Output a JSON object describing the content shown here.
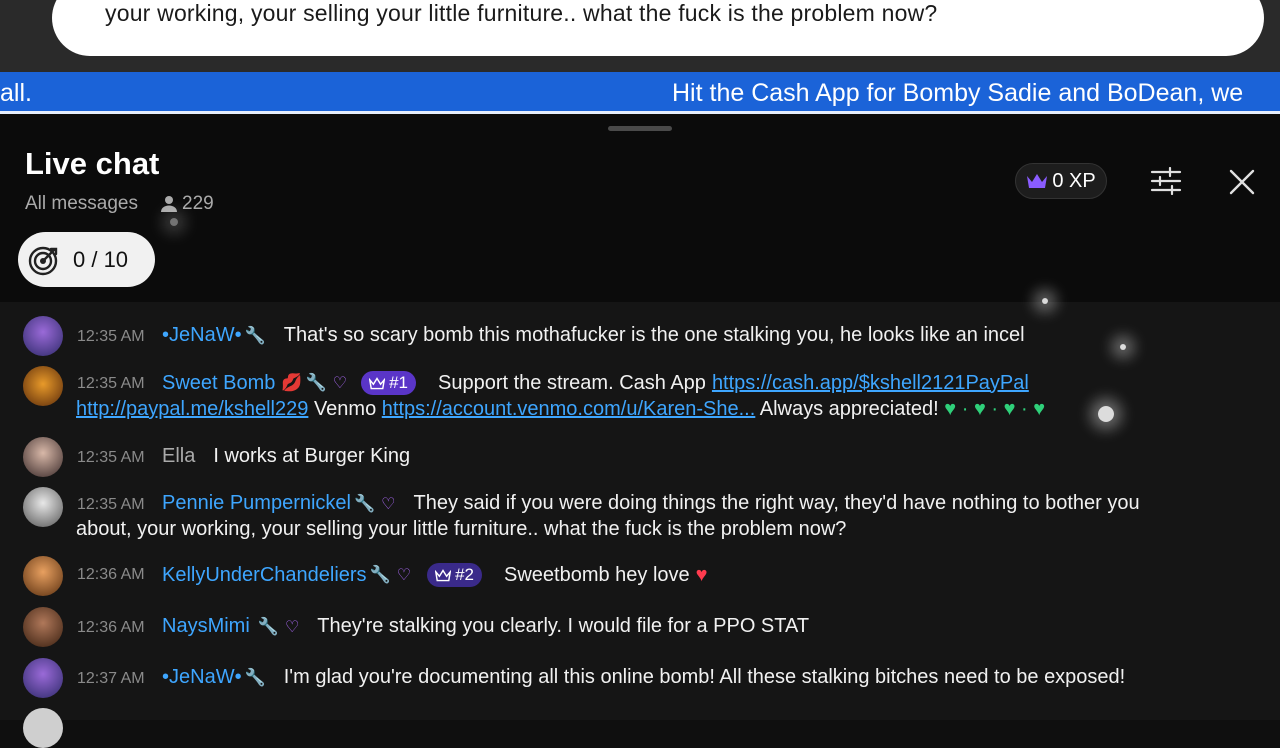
{
  "overlay": {
    "bubble_text": "your working, your selling your little furniture.. what the fuck is the problem now?",
    "ticker_left": "all.",
    "ticker_right": "Hit the Cash App for Bomby Sadie and BoDean, we"
  },
  "header": {
    "title": "Live chat",
    "filter_label": "All messages",
    "viewer_count": "229",
    "goal_progress": "0 / 10",
    "xp_label": "0 XP"
  },
  "messages": [
    {
      "time": "12:35 AM",
      "author": "•JeNaW•",
      "text": "That's so scary bomb this mothafucker is the one stalking you, he looks like an incel"
    },
    {
      "time": "12:35 AM",
      "author": "Sweet Bomb",
      "rank": "#1",
      "text_a": "Support the stream. Cash App",
      "link_1": "https://cash.app/$kshell2121PayPal",
      "link_2": "http://paypal.me/kshell229",
      "text_b": "Venmo",
      "link_3": "https://account.venmo.com/u/Karen-She...",
      "text_c": "Always appreciated!"
    },
    {
      "time": "12:35 AM",
      "author": "Ella",
      "text": "I works at Burger King"
    },
    {
      "time": "12:35 AM",
      "author": "Pennie Pumpernickel",
      "text": "They said if you were doing things the right way, they'd have nothing to bother you",
      "text_2": "about, your working, your selling your little furniture.. what the fuck is the problem now?"
    },
    {
      "time": "12:36 AM",
      "author": "KellyUnderChandeliers",
      "rank": "#2",
      "text": "Sweetbomb hey love"
    },
    {
      "time": "12:36 AM",
      "author": "NaysMimi",
      "text": "They're stalking you clearly. I would file for a PPO STAT"
    },
    {
      "time": "12:37 AM",
      "author": "•JeNaW•",
      "text": "I'm glad you're documenting all this online bomb! All these stalking bitches need to be exposed!"
    }
  ],
  "icons": [
    "crown-icon",
    "sliders-icon",
    "close-icon",
    "target-icon",
    "person-icon",
    "wrench-icon",
    "heart-icon",
    "lips-icon"
  ],
  "colors": {
    "author": "#3ea6ff",
    "ticker": "#1b63d8",
    "rank_badge": "#5a35c8",
    "member_heart": "#b06cff"
  }
}
